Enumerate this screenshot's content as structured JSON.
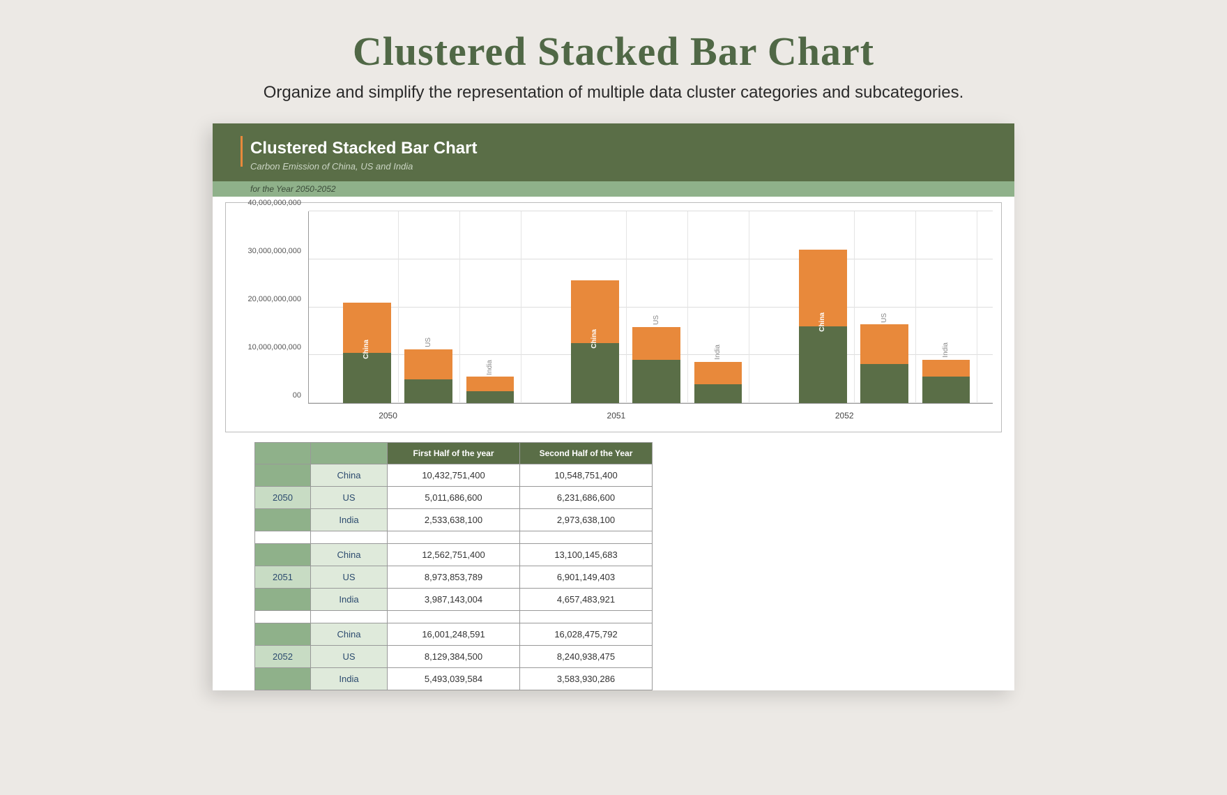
{
  "page": {
    "title": "Clustered Stacked Bar Chart",
    "subtitle": "Organize and simplify the representation of multiple data cluster categories and subcategories."
  },
  "doc_header": {
    "title": "Clustered Stacked Bar Chart",
    "sub": "Carbon Emission of China, US and India",
    "strip": "for the Year 2050-2052"
  },
  "table": {
    "col1": "First Half of the year",
    "col2": "Second Half of the Year",
    "years": [
      {
        "year": "2050",
        "rows": [
          {
            "country": "China",
            "v1": "10,432,751,400",
            "v2": "10,548,751,400"
          },
          {
            "country": "US",
            "v1": "5,011,686,600",
            "v2": "6,231,686,600"
          },
          {
            "country": "India",
            "v1": "2,533,638,100",
            "v2": "2,973,638,100"
          }
        ]
      },
      {
        "year": "2051",
        "rows": [
          {
            "country": "China",
            "v1": "12,562,751,400",
            "v2": "13,100,145,683"
          },
          {
            "country": "US",
            "v1": "8,973,853,789",
            "v2": "6,901,149,403"
          },
          {
            "country": "India",
            "v1": "3,987,143,004",
            "v2": "4,657,483,921"
          }
        ]
      },
      {
        "year": "2052",
        "rows": [
          {
            "country": "China",
            "v1": "16,001,248,591",
            "v2": "16,028,475,792"
          },
          {
            "country": "US",
            "v1": "8,129,384,500",
            "v2": "8,240,938,475"
          },
          {
            "country": "India",
            "v1": "5,493,039,584",
            "v2": "3,583,930,286"
          }
        ]
      }
    ]
  },
  "chart_data": {
    "type": "bar",
    "stacked": true,
    "clustered": true,
    "ylim": [
      0,
      40000000000
    ],
    "yticks": [
      "00",
      "10,000,000,000",
      "20,000,000,000",
      "30,000,000,000",
      "40,000,000,000"
    ],
    "categories": [
      "2050",
      "2051",
      "2052"
    ],
    "countries": [
      "China",
      "US",
      "India"
    ],
    "series": [
      {
        "name": "First Half of the year",
        "color": "#5a6e47"
      },
      {
        "name": "Second Half of the Year",
        "color": "#e8893b"
      }
    ],
    "data": {
      "2050": {
        "China": [
          10432751400,
          10548751400
        ],
        "US": [
          5011686600,
          6231686600
        ],
        "India": [
          2533638100,
          2973638100
        ]
      },
      "2051": {
        "China": [
          12562751400,
          13100145683
        ],
        "US": [
          8973853789,
          6901149403
        ],
        "India": [
          3987143004,
          4657483921
        ]
      },
      "2052": {
        "China": [
          16001248591,
          16028475792
        ],
        "US": [
          8129384500,
          8240938475
        ],
        "India": [
          5493039584,
          3583930286
        ]
      }
    }
  }
}
